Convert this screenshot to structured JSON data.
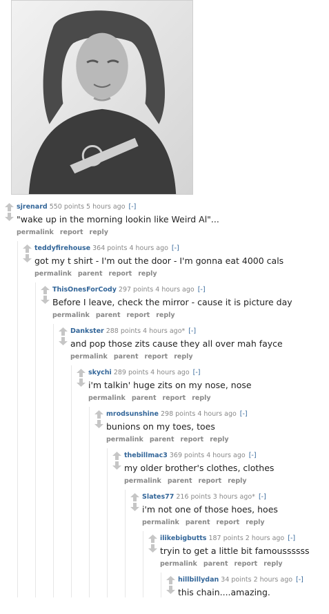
{
  "image": {
    "icon": "yearbook-photo"
  },
  "colors": {
    "author": "#336699",
    "meta": "#888888",
    "text": "#222222",
    "arrow": "#c6c6c6"
  },
  "comments": [
    {
      "author": "sjrenard",
      "score": "550 points",
      "time": "5 hours ago",
      "collapse": "[-]",
      "body": "\"wake up in the morning lookin like Weird Al\"...",
      "buttons": [
        "permalink",
        "report",
        "reply"
      ]
    },
    {
      "author": "teddyfirehouse",
      "score": "364 points",
      "time": "4 hours ago",
      "collapse": "[-]",
      "body": "got my t shirt - I'm out the door - I'm gonna eat 4000 cals",
      "buttons": [
        "permalink",
        "parent",
        "report",
        "reply"
      ]
    },
    {
      "author": "ThisOnesForCody",
      "score": "297 points",
      "time": "4 hours ago",
      "collapse": "[-]",
      "body": "Before I leave, check the mirror - cause it is picture day",
      "buttons": [
        "permalink",
        "parent",
        "report",
        "reply"
      ]
    },
    {
      "author": "Dankster",
      "score": "288 points",
      "time": "4 hours ago*",
      "collapse": "[-]",
      "body": "and pop those zits cause they all over mah fayce",
      "buttons": [
        "permalink",
        "parent",
        "report",
        "reply"
      ]
    },
    {
      "author": "skychi",
      "score": "289 points",
      "time": "4 hours ago",
      "collapse": "[-]",
      "body": "i'm talkin' huge zits on my nose, nose",
      "buttons": [
        "permalink",
        "parent",
        "report",
        "reply"
      ]
    },
    {
      "author": "mrodsunshine",
      "score": "298 points",
      "time": "4 hours ago",
      "collapse": "[-]",
      "body": "bunions on my toes, toes",
      "buttons": [
        "permalink",
        "parent",
        "report",
        "reply"
      ]
    },
    {
      "author": "thebillmac3",
      "score": "369 points",
      "time": "4 hours ago",
      "collapse": "[-]",
      "body": "my older brother's clothes, clothes",
      "buttons": [
        "permalink",
        "parent",
        "report",
        "reply"
      ]
    },
    {
      "author": "Slates77",
      "score": "216 points",
      "time": "3 hours ago*",
      "collapse": "[-]",
      "body": "i'm not one of those hoes, hoes",
      "buttons": [
        "permalink",
        "parent",
        "report",
        "reply"
      ]
    },
    {
      "author": "ilikebigbutts",
      "score": "187 points",
      "time": "2 hours ago",
      "collapse": "[-]",
      "body": "tryin to get a little bit famoussssss",
      "buttons": [
        "permalink",
        "parent",
        "report",
        "reply"
      ]
    },
    {
      "author": "hillbillydan",
      "score": "34 points",
      "time": "2 hours ago",
      "collapse": "[-]",
      "body": "this chain....amazing.",
      "buttons": []
    }
  ]
}
